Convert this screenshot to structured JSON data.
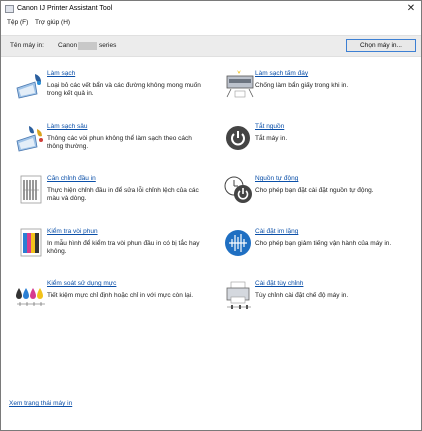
{
  "window": {
    "title": "Canon IJ Printer Assistant Tool",
    "close_glyph": "✕"
  },
  "menu": [
    "Tệp (F)",
    "Trợ giúp (H)"
  ],
  "printer": {
    "label": "Tên máy in:",
    "model": "Canon",
    "series": "series",
    "select_button": "Chọn máy in..."
  },
  "left_items": [
    {
      "title": "Làm sạch",
      "desc": "Loại bỏ các vết bẩn và các đường không mong muốn trong kết quả in.",
      "icon": "cleaning-icon"
    },
    {
      "title": "Làm sạch sâu",
      "desc": "Thông các vòi phun không thể làm sạch theo cách thông thường.",
      "icon": "deep-cleaning-icon"
    },
    {
      "title": "Căn chỉnh đầu in",
      "desc": "Thực hiện chỉnh đầu in để sửa lỗi chỉnh lệch của các màu và dòng.",
      "icon": "print-head-alignment-icon"
    },
    {
      "title": "Kiểm tra vòi phun",
      "desc": "In mẫu hình để kiểm tra vòi phun đầu in có bị tắc hay không.",
      "icon": "nozzle-check-icon"
    },
    {
      "title": "Kiểm soát sử dụng mực",
      "desc": "Tiết kiệm mực chỉ định hoặc chỉ in với mực còn lại.",
      "icon": "ink-usage-icon"
    }
  ],
  "right_items": [
    {
      "title": "Làm sạch tấm đáy",
      "desc": "Chống làm bẩn giấy trong khi in.",
      "icon": "bottom-plate-cleaning-icon"
    },
    {
      "title": "Tắt nguồn",
      "desc": "Tắt máy in.",
      "icon": "power-off-icon"
    },
    {
      "title": "Nguồn tự động",
      "desc": "Cho phép bạn đặt cài đặt nguồn tự động.",
      "icon": "auto-power-icon"
    },
    {
      "title": "Cài đặt im lặng",
      "desc": "Cho phép bạn giảm tiếng vận hành của máy in.",
      "icon": "quiet-settings-icon"
    },
    {
      "title": "Cài đặt tùy chỉnh",
      "desc": "Tùy chỉnh cài đặt chế độ máy in.",
      "icon": "custom-settings-icon"
    }
  ],
  "footer_link": "Xem trạng thái máy in",
  "colors": {
    "link": "#0a4fa8",
    "accent": "#2a7fd4",
    "dark_icon": "#444444"
  }
}
